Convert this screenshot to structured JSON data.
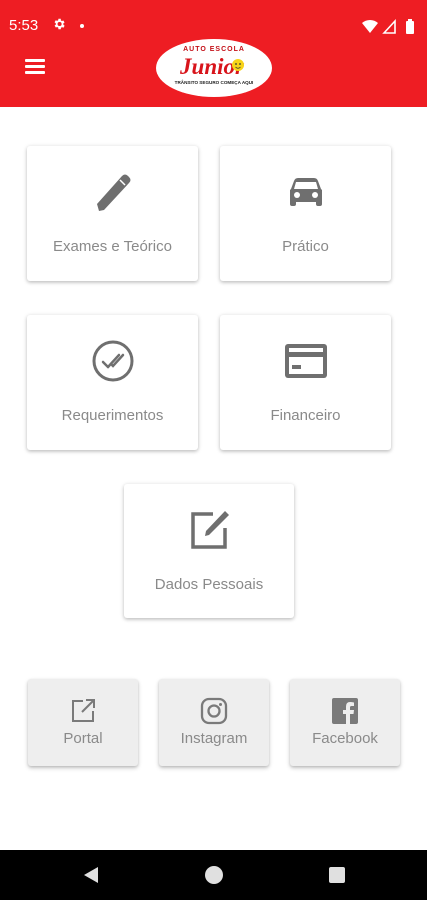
{
  "status_bar": {
    "time": "5:53",
    "icons": [
      "gear-icon",
      "notification-dot",
      "wifi-icon",
      "signal-icon",
      "battery-icon"
    ]
  },
  "app_bar": {
    "menu_icon": "hamburger-menu-icon",
    "logo": {
      "top_text": "AUTO ESCOLA",
      "brand": "Junior",
      "bottom_text": "TRÂNSITO SEGURO COMEÇA AQUI"
    }
  },
  "tiles": [
    {
      "label": "Exames e Teórico",
      "icon": "pencil-icon"
    },
    {
      "label": "Prático",
      "icon": "car-icon"
    },
    {
      "label": "Requerimentos",
      "icon": "check-circle-icon"
    },
    {
      "label": "Financeiro",
      "icon": "credit-card-icon"
    },
    {
      "label": "Dados Pessoais",
      "icon": "edit-square-icon"
    }
  ],
  "links": [
    {
      "label": "Portal",
      "icon": "external-link-icon"
    },
    {
      "label": "Instagram",
      "icon": "instagram-icon"
    },
    {
      "label": "Facebook",
      "icon": "facebook-icon"
    }
  ],
  "nav_bar": {
    "icons": [
      "back-icon",
      "home-icon",
      "recents-icon"
    ]
  },
  "colors": {
    "accent": "#ee1d23",
    "icon_grey": "#6f6f6f",
    "label_grey": "#8a8a8a",
    "button_bg": "#eeeeee"
  }
}
